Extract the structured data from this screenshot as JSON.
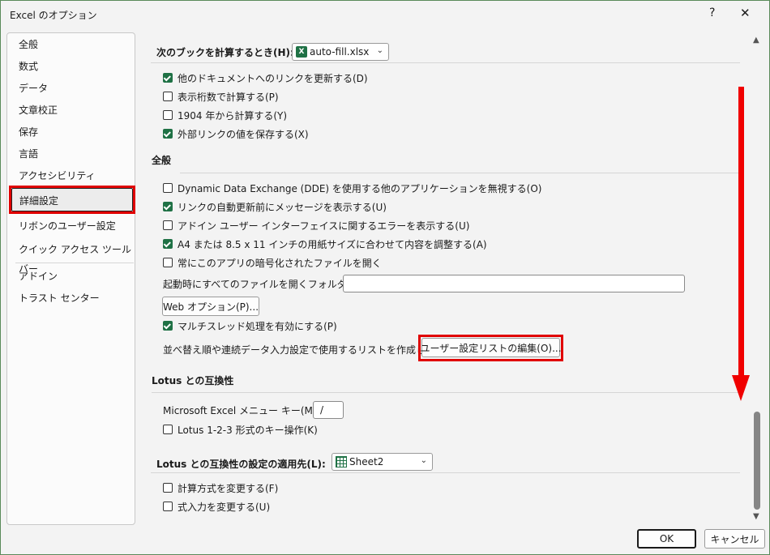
{
  "window": {
    "title": "Excel のオプション",
    "help_glyph": "?",
    "close_glyph": "✕"
  },
  "sidebar": {
    "items": [
      {
        "label": "全般"
      },
      {
        "label": "数式"
      },
      {
        "label": "データ"
      },
      {
        "label": "文章校正"
      },
      {
        "label": "保存"
      },
      {
        "label": "言語"
      },
      {
        "label": "アクセシビリティ"
      },
      {
        "label": "詳細設定",
        "selected": true
      },
      {
        "label": "リボンのユーザー設定"
      },
      {
        "label": "クイック アクセス ツール バー"
      },
      {
        "label": "アドイン"
      },
      {
        "label": "トラスト センター"
      }
    ]
  },
  "calc_section": {
    "label": "次のブックを計算するとき(H):",
    "workbook": "auto-fill.xlsx",
    "options": [
      {
        "label": "他のドキュメントへのリンクを更新する(D)",
        "checked": true
      },
      {
        "label": "表示桁数で計算する(P)",
        "checked": false
      },
      {
        "label": "1904 年から計算する(Y)",
        "checked": false
      },
      {
        "label": "外部リンクの値を保存する(X)",
        "checked": true
      }
    ]
  },
  "general_section": {
    "header": "全般",
    "options": [
      {
        "label": "Dynamic Data Exchange (DDE) を使用する他のアプリケーションを無視する(O)",
        "checked": false
      },
      {
        "label": "リンクの自動更新前にメッセージを表示する(U)",
        "checked": true
      },
      {
        "label": "アドイン ユーザー インターフェイスに関するエラーを表示する(U)",
        "checked": false
      },
      {
        "label": "A4 または 8.5 x 11 インチの用紙サイズに合わせて内容を調整する(A)",
        "checked": true
      },
      {
        "label": "常にこのアプリの暗号化されたファイルを開く",
        "checked": false
      }
    ],
    "startup_folder_label": "起動時にすべてのファイルを開くフォルダー(L):",
    "startup_folder_value": "",
    "web_options_button": "Web オプション(P)...",
    "multithread": {
      "label": "マルチスレッド処理を有効にする(P)",
      "checked": true
    },
    "custom_list_label": "並べ替え順や連続データ入力設定で使用するリストを作成します:",
    "custom_list_button": "ユーザー設定リストの編集(O)..."
  },
  "lotus_section": {
    "header": "Lotus との互換性",
    "menu_key_label": "Microsoft Excel メニュー キー(M):",
    "menu_key_value": "/",
    "transition_keys": {
      "label": "Lotus 1-2-3 形式のキー操作(K)",
      "checked": false
    }
  },
  "lotus_apply_section": {
    "label": "Lotus との互換性の設定の適用先(L):",
    "sheet": "Sheet2",
    "options": [
      {
        "label": "計算方式を変更する(F)",
        "checked": false
      },
      {
        "label": "式入力を変更する(U)",
        "checked": false
      }
    ]
  },
  "footer": {
    "ok": "OK",
    "cancel": "キャンセル"
  },
  "colors": {
    "accent_green": "#1f7145",
    "highlight_red": "#e00000"
  }
}
